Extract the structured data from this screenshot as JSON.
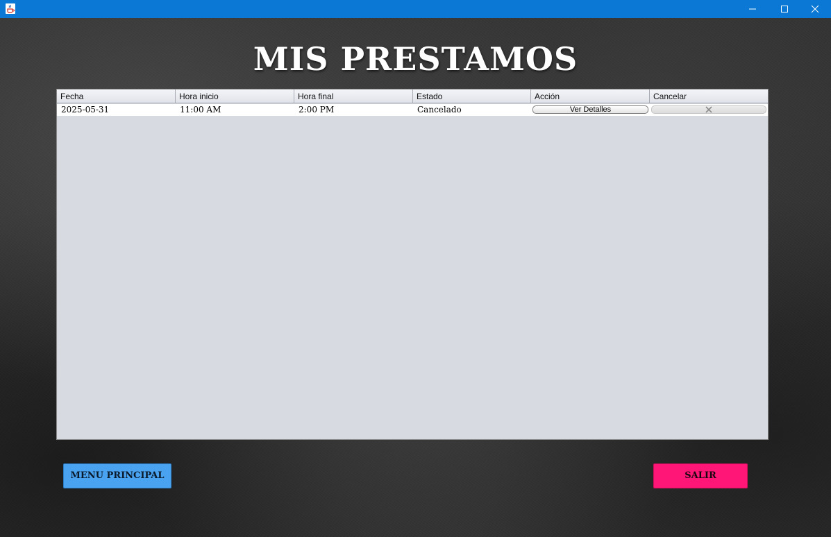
{
  "window": {
    "icon": "java-cup-icon",
    "controls": [
      "minimize-icon",
      "maximize-icon",
      "close-icon"
    ]
  },
  "page": {
    "title": "MIS PRESTAMOS"
  },
  "table": {
    "columns": [
      "Fecha",
      "Hora inicio",
      "Hora final",
      "Estado",
      "Acción",
      "Cancelar"
    ],
    "rows": [
      {
        "fecha": "2025-05-31",
        "hora_inicio": "11:00 AM",
        "hora_final": "2:00 PM",
        "estado": "Cancelado",
        "accion_label": "Ver Detalles",
        "cancelar_icon": "close-x-icon"
      }
    ]
  },
  "buttons": {
    "menu_principal": "MENU PRINCIPAL",
    "salir": "SALIR"
  },
  "colors": {
    "titlebar": "#0a78d4",
    "menu_button": "#4aa3f0",
    "salir_button": "#ff1676",
    "table_background": "#d8dae1"
  }
}
